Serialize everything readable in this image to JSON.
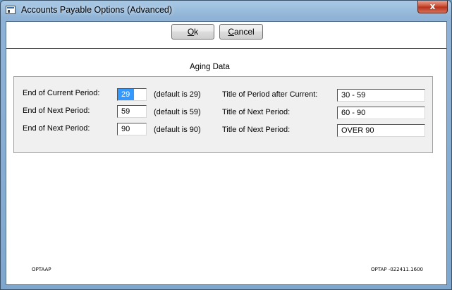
{
  "window": {
    "title": "Accounts Payable Options (Advanced)",
    "close_glyph": "x"
  },
  "buttons": {
    "ok_mnemonic": "O",
    "ok_rest": "k",
    "cancel_mnemonic": "C",
    "cancel_rest": "ancel"
  },
  "section": {
    "title": "Aging Data"
  },
  "rows": [
    {
      "label": "End of Current Period:",
      "value": "29",
      "default_text": "(default is 29)",
      "title_label": "Title of Period after Current:",
      "title_value": "30 - 59"
    },
    {
      "label": "End of Next Period:",
      "value": "59",
      "default_text": "(default is 59)",
      "title_label": "Title of Next Period:",
      "title_value": "60 - 90"
    },
    {
      "label": "End of Next Period:",
      "value": "90",
      "default_text": "(default is 90)",
      "title_label": "Title of Next Period:",
      "title_value": "OVER 90"
    }
  ],
  "footer": {
    "left_code": "OPTAAP",
    "right_code": "OPTAP -022411.1600"
  },
  "colors": {
    "selection": "#3399ff",
    "close_button": "#c9462c",
    "frame": "#8fb3d6"
  }
}
